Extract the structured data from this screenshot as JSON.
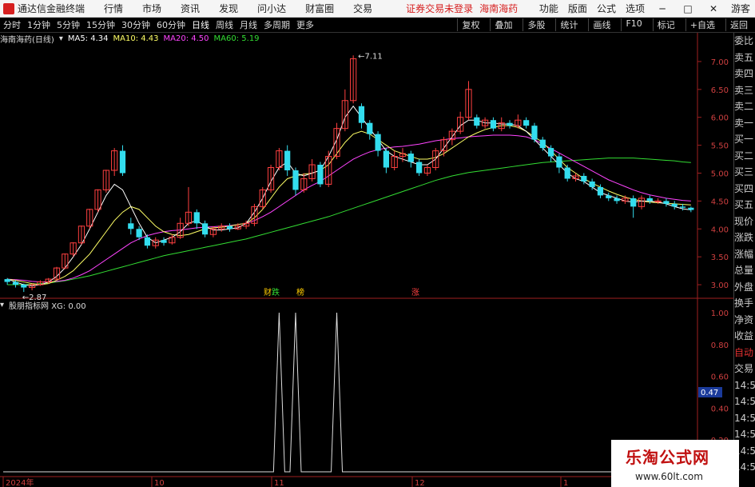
{
  "titlebar": {
    "app_name": "通达信金融终端",
    "menu": [
      "行情",
      "市场",
      "资讯",
      "发现",
      "问小达",
      "财富圈",
      "交易"
    ],
    "notice": "证券交易未登录",
    "stock_name": "海南海药",
    "right_items": [
      "功能",
      "版面",
      "公式",
      "选项"
    ],
    "guest_label": "游客",
    "r_badge": "R"
  },
  "periodbar": {
    "periods": [
      "分时",
      "1分钟",
      "5分钟",
      "15分钟",
      "30分钟",
      "60分钟",
      "日线",
      "周线",
      "月线",
      "多周期",
      "更多"
    ],
    "active": "日线",
    "tools": [
      "复权",
      "叠加",
      "多股",
      "统计",
      "画线",
      "F10",
      "标记",
      "+自选",
      "返回"
    ]
  },
  "main_chart": {
    "title": "海南海药(日线)",
    "ma5_label": "MA5: 4.34",
    "ma10_label": "MA10: 4.43",
    "ma20_label": "MA20: 4.50",
    "ma60_label": "MA60: 5.19",
    "colors": {
      "ma5": "#ffffff",
      "ma10": "#ffff66",
      "ma20": "#ff44ff",
      "ma60": "#33dd33",
      "up": "#ff4040",
      "down": "#33ddee"
    },
    "high_label": "7.11",
    "low_label": "2.87",
    "events": [
      "财",
      "跌",
      "榜",
      "涨"
    ],
    "price_ticks": [
      "7.00",
      "6.50",
      "6.00",
      "5.50",
      "5.00",
      "4.50",
      "4.00",
      "3.50",
      "3.00"
    ]
  },
  "sub_chart": {
    "title": "股朋指标网 XG: 0.00",
    "ticks": [
      "1.00",
      "0.80",
      "0.60",
      "0.40",
      "0.20"
    ],
    "current_value": "0.47",
    "xg_signal_values": [
      1,
      1,
      1
    ]
  },
  "date_axis": [
    "2024年",
    "10",
    "11",
    "12",
    "1"
  ],
  "sidepanel": {
    "items": [
      "委比",
      "卖五",
      "卖四",
      "卖三",
      "卖二",
      "卖一",
      "买一",
      "买二",
      "买三",
      "买四",
      "买五",
      "现价",
      "涨跌",
      "涨幅",
      "总量",
      "外盘",
      "换手",
      "净资",
      "收益",
      "自动",
      "交易",
      "14:56",
      "14:56",
      "14:56",
      "14:56",
      "14:56",
      "14:56",
      "14:56",
      "14:56"
    ]
  },
  "watermark": {
    "title": "乐淘公式网",
    "url": "www.60lt.com"
  },
  "chart_data": {
    "type": "candlestick",
    "ylim": [
      2.8,
      7.3
    ],
    "candles": [
      [
        3.1,
        3.05,
        3.12,
        3.0
      ],
      [
        3.05,
        3.0,
        3.08,
        2.95
      ],
      [
        3.0,
        2.95,
        3.02,
        2.87
      ],
      [
        2.95,
        3.0,
        3.02,
        2.9
      ],
      [
        3.0,
        3.05,
        3.08,
        2.98
      ],
      [
        3.05,
        3.1,
        3.12,
        3.02
      ],
      [
        3.1,
        3.3,
        3.32,
        3.08
      ],
      [
        3.3,
        3.55,
        3.56,
        3.28
      ],
      [
        3.55,
        3.75,
        3.76,
        3.5
      ],
      [
        3.75,
        4.05,
        4.06,
        3.72
      ],
      [
        4.05,
        4.35,
        4.36,
        4.0
      ],
      [
        4.35,
        4.7,
        4.71,
        4.3
      ],
      [
        4.7,
        5.05,
        5.06,
        4.65
      ],
      [
        5.05,
        5.4,
        5.45,
        4.95
      ],
      [
        5.4,
        5.0,
        5.5,
        4.95
      ],
      [
        4.1,
        4.0,
        4.2,
        3.9
      ],
      [
        4.0,
        3.85,
        4.05,
        3.8
      ],
      [
        3.85,
        3.7,
        3.9,
        3.65
      ],
      [
        3.7,
        3.8,
        3.85,
        3.65
      ],
      [
        3.8,
        3.75,
        3.85,
        3.7
      ],
      [
        3.75,
        3.85,
        3.9,
        3.72
      ],
      [
        3.85,
        4.1,
        4.2,
        3.82
      ],
      [
        4.1,
        4.3,
        4.75,
        4.05
      ],
      [
        4.3,
        4.1,
        4.35,
        4.0
      ],
      [
        4.1,
        3.9,
        4.15,
        3.85
      ],
      [
        3.9,
        4.0,
        4.05,
        3.85
      ],
      [
        4.0,
        4.05,
        4.1,
        3.95
      ],
      [
        4.05,
        4.0,
        4.1,
        3.95
      ],
      [
        4.0,
        4.05,
        4.1,
        3.98
      ],
      [
        4.05,
        4.1,
        4.15,
        4.0
      ],
      [
        4.1,
        4.4,
        4.45,
        4.05
      ],
      [
        4.4,
        4.7,
        4.75,
        4.35
      ],
      [
        4.7,
        5.1,
        5.15,
        4.65
      ],
      [
        5.1,
        5.4,
        5.45,
        5.05
      ],
      [
        5.4,
        5.05,
        5.5,
        4.95
      ],
      [
        5.05,
        4.7,
        5.1,
        4.6
      ],
      [
        4.7,
        4.9,
        5.0,
        4.65
      ],
      [
        4.9,
        5.15,
        5.25,
        4.85
      ],
      [
        5.15,
        4.8,
        5.2,
        4.75
      ],
      [
        4.8,
        5.3,
        5.4,
        4.75
      ],
      [
        5.3,
        5.8,
        5.9,
        5.25
      ],
      [
        5.8,
        6.3,
        6.5,
        5.75
      ],
      [
        6.3,
        7.05,
        7.11,
        6.25
      ],
      [
        6.2,
        5.9,
        6.25,
        5.8
      ],
      [
        5.9,
        5.7,
        5.95,
        5.6
      ],
      [
        5.7,
        5.4,
        5.75,
        5.3
      ],
      [
        5.4,
        5.1,
        5.45,
        5.0
      ],
      [
        5.1,
        5.3,
        5.4,
        5.05
      ],
      [
        5.3,
        5.35,
        5.45,
        5.2
      ],
      [
        5.35,
        5.2,
        5.4,
        5.1
      ],
      [
        5.2,
        5.0,
        5.25,
        4.95
      ],
      [
        5.0,
        5.1,
        5.15,
        4.95
      ],
      [
        5.1,
        5.4,
        5.45,
        5.05
      ],
      [
        5.4,
        5.6,
        5.65,
        5.3
      ],
      [
        5.6,
        5.75,
        5.8,
        5.5
      ],
      [
        5.75,
        6.0,
        6.1,
        5.7
      ],
      [
        6.0,
        6.5,
        6.65,
        5.95
      ],
      [
        6.0,
        5.85,
        6.05,
        5.8
      ],
      [
        5.85,
        5.95,
        6.0,
        5.8
      ],
      [
        5.95,
        5.8,
        6.0,
        5.75
      ],
      [
        5.8,
        5.9,
        6.0,
        5.75
      ],
      [
        5.9,
        5.85,
        5.95,
        5.8
      ],
      [
        5.85,
        5.95,
        6.05,
        5.8
      ],
      [
        5.95,
        5.85,
        6.0,
        5.8
      ],
      [
        5.85,
        5.6,
        5.9,
        5.55
      ],
      [
        5.6,
        5.45,
        5.65,
        5.4
      ],
      [
        5.45,
        5.3,
        5.5,
        5.2
      ],
      [
        5.3,
        5.1,
        5.35,
        5.0
      ],
      [
        5.1,
        4.9,
        5.15,
        4.85
      ],
      [
        4.9,
        4.95,
        5.0,
        4.85
      ],
      [
        4.95,
        4.85,
        5.0,
        4.8
      ],
      [
        4.85,
        4.75,
        4.9,
        4.7
      ],
      [
        4.75,
        4.6,
        4.8,
        4.55
      ],
      [
        4.6,
        4.55,
        4.65,
        4.5
      ],
      [
        4.55,
        4.5,
        4.6,
        4.45
      ],
      [
        4.5,
        4.55,
        4.6,
        4.45
      ],
      [
        4.55,
        4.4,
        4.6,
        4.2
      ],
      [
        4.4,
        4.55,
        4.6,
        4.35
      ],
      [
        4.55,
        4.5,
        4.6,
        4.45
      ],
      [
        4.5,
        4.5,
        4.55,
        4.45
      ],
      [
        4.5,
        4.45,
        4.55,
        4.4
      ],
      [
        4.45,
        4.4,
        4.5,
        4.35
      ],
      [
        4.4,
        4.38,
        4.45,
        4.33
      ],
      [
        4.38,
        4.34,
        4.4,
        4.3
      ]
    ],
    "ma5": [
      3.1,
      3.05,
      3.0,
      2.98,
      3.0,
      3.05,
      3.15,
      3.3,
      3.5,
      3.72,
      4.0,
      4.3,
      4.6,
      4.8,
      4.7,
      4.4,
      4.1,
      3.85,
      3.75,
      3.8,
      3.85,
      3.95,
      4.1,
      4.15,
      4.05,
      3.98,
      3.98,
      4.0,
      4.02,
      4.1,
      4.3,
      4.55,
      4.85,
      5.1,
      5.2,
      5.0,
      4.95,
      5.0,
      5.05,
      5.3,
      5.6,
      6.0,
      6.2,
      6.0,
      5.8,
      5.6,
      5.4,
      5.3,
      5.25,
      5.2,
      5.15,
      5.15,
      5.25,
      5.45,
      5.65,
      5.85,
      5.95,
      5.95,
      5.9,
      5.9,
      5.88,
      5.88,
      5.85,
      5.75,
      5.6,
      5.45,
      5.3,
      5.15,
      5.0,
      4.9,
      4.85,
      4.75,
      4.65,
      4.6,
      4.55,
      4.5,
      4.48,
      4.5,
      4.5,
      4.48,
      4.45,
      4.4,
      4.36,
      4.34
    ],
    "ma10": [
      3.1,
      3.08,
      3.05,
      3.02,
      3.0,
      3.02,
      3.08,
      3.15,
      3.25,
      3.4,
      3.55,
      3.75,
      3.95,
      4.15,
      4.3,
      4.4,
      4.35,
      4.2,
      4.05,
      3.95,
      3.9,
      3.88,
      3.9,
      3.95,
      4.0,
      4.02,
      4.03,
      4.05,
      4.08,
      4.1,
      4.2,
      4.35,
      4.55,
      4.75,
      4.9,
      4.95,
      4.98,
      5.0,
      5.05,
      5.15,
      5.35,
      5.55,
      5.7,
      5.75,
      5.7,
      5.6,
      5.5,
      5.4,
      5.35,
      5.3,
      5.25,
      5.25,
      5.28,
      5.35,
      5.45,
      5.55,
      5.65,
      5.72,
      5.78,
      5.82,
      5.85,
      5.85,
      5.82,
      5.75,
      5.65,
      5.55,
      5.4,
      5.25,
      5.1,
      5.0,
      4.9,
      4.82,
      4.75,
      4.68,
      4.62,
      4.57,
      4.53,
      4.5,
      4.48,
      4.47,
      4.46,
      4.45,
      4.44,
      4.43
    ],
    "ma20": [
      3.1,
      3.09,
      3.08,
      3.06,
      3.05,
      3.05,
      3.06,
      3.08,
      3.12,
      3.18,
      3.25,
      3.35,
      3.45,
      3.55,
      3.65,
      3.75,
      3.82,
      3.88,
      3.92,
      3.95,
      3.97,
      3.98,
      4.0,
      4.02,
      4.03,
      4.04,
      4.05,
      4.06,
      4.08,
      4.1,
      4.15,
      4.22,
      4.3,
      4.4,
      4.5,
      4.6,
      4.7,
      4.78,
      4.85,
      4.95,
      5.05,
      5.15,
      5.25,
      5.32,
      5.38,
      5.42,
      5.45,
      5.47,
      5.48,
      5.5,
      5.52,
      5.55,
      5.58,
      5.6,
      5.62,
      5.63,
      5.65,
      5.66,
      5.67,
      5.68,
      5.68,
      5.68,
      5.67,
      5.65,
      5.6,
      5.52,
      5.44,
      5.36,
      5.28,
      5.2,
      5.12,
      5.04,
      4.96,
      4.88,
      4.82,
      4.76,
      4.7,
      4.65,
      4.61,
      4.58,
      4.55,
      4.53,
      4.51,
      4.5
    ],
    "ma60": [
      3.0,
      3.0,
      3.0,
      3.01,
      3.02,
      3.03,
      3.05,
      3.07,
      3.1,
      3.13,
      3.16,
      3.2,
      3.24,
      3.28,
      3.32,
      3.36,
      3.4,
      3.44,
      3.48,
      3.52,
      3.55,
      3.58,
      3.61,
      3.64,
      3.67,
      3.7,
      3.73,
      3.76,
      3.79,
      3.82,
      3.86,
      3.9,
      3.94,
      3.98,
      4.02,
      4.06,
      4.1,
      4.14,
      4.18,
      4.22,
      4.27,
      4.32,
      4.37,
      4.42,
      4.47,
      4.52,
      4.57,
      4.62,
      4.67,
      4.72,
      4.77,
      4.82,
      4.87,
      4.91,
      4.95,
      4.98,
      5.01,
      5.03,
      5.05,
      5.07,
      5.09,
      5.11,
      5.13,
      5.15,
      5.17,
      5.19,
      5.2,
      5.21,
      5.22,
      5.23,
      5.24,
      5.25,
      5.26,
      5.27,
      5.27,
      5.27,
      5.27,
      5.26,
      5.25,
      5.24,
      5.23,
      5.22,
      5.2,
      5.19
    ]
  }
}
